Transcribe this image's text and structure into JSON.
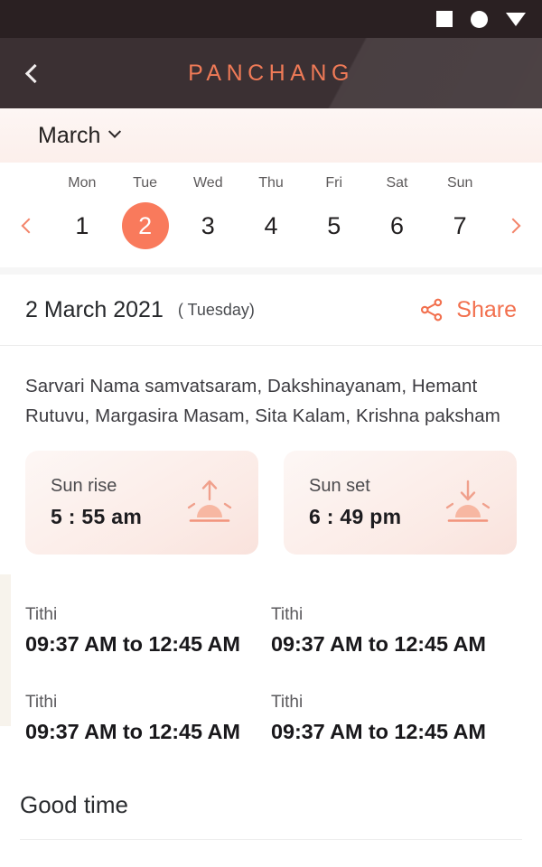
{
  "statusbar": {
    "icons": [
      "recents-square-icon",
      "home-circle-icon",
      "back-triangle-icon"
    ]
  },
  "appbar": {
    "back_icon": "chevron-left-icon",
    "title": "PANCHANG",
    "title_color": "#ef7a57",
    "background_color": "#3b3033"
  },
  "month_selector": {
    "month": "March",
    "chevron_icon": "chevron-down-icon"
  },
  "week_strip": {
    "prev_icon": "chevron-left-icon",
    "next_icon": "chevron-right-icon",
    "accent_color": "#f97a5c",
    "days": [
      {
        "name": "Mon",
        "num": "1",
        "selected": false
      },
      {
        "name": "Tue",
        "num": "2",
        "selected": true
      },
      {
        "name": "Wed",
        "num": "3",
        "selected": false
      },
      {
        "name": "Thu",
        "num": "4",
        "selected": false
      },
      {
        "name": "Fri",
        "num": "5",
        "selected": false
      },
      {
        "name": "Sat",
        "num": "6",
        "selected": false
      },
      {
        "name": "Sun",
        "num": "7",
        "selected": false
      }
    ]
  },
  "date_row": {
    "date": "2 March 2021",
    "weekday": "( Tuesday)",
    "share_label": "Share",
    "share_icon": "share-nodes-icon",
    "share_color": "#f2704e"
  },
  "description": "Sarvari Nama samvatsaram, Dakshinayanam, Hemant Rutuvu, Margasira Masam, Sita Kalam, Krishna paksham",
  "sun_cards": [
    {
      "label": "Sun rise",
      "time": "5 : 55 am",
      "icon": "sunrise-icon"
    },
    {
      "label": "Sun set",
      "time": "6 : 49 pm",
      "icon": "sunset-icon"
    }
  ],
  "tithi_entries": [
    {
      "label": "Tithi",
      "value": "09:37 AM to 12:45 AM"
    },
    {
      "label": "Tithi",
      "value": "09:37 AM to 12:45 AM"
    },
    {
      "label": "Tithi",
      "value": "09:37 AM to 12:45 AM"
    },
    {
      "label": "Tithi",
      "value": "09:37 AM to 12:45 AM"
    }
  ],
  "good_time": {
    "heading": "Good time"
  }
}
